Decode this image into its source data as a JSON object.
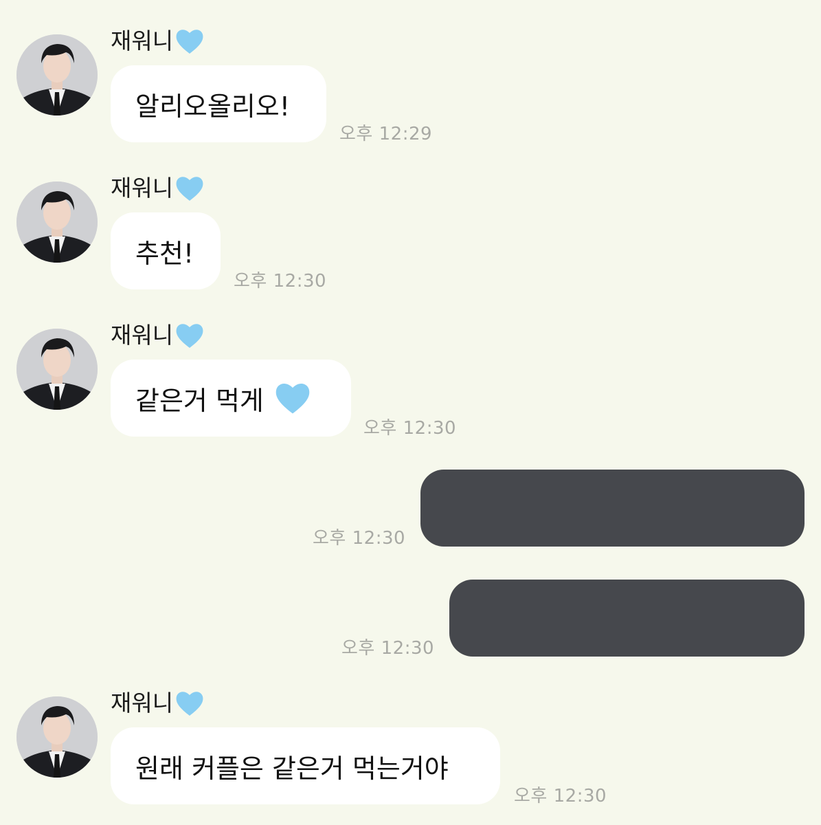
{
  "sender_name": "재워니",
  "colors": {
    "background": "#f6f8ec",
    "incoming_bubble": "#ffffff",
    "outgoing_bubble": "#46484d",
    "timestamp": "#a8a9a4",
    "heart": "#87cdf2"
  },
  "icons": {
    "heart": "blue-heart-icon",
    "avatar": "profile-avatar"
  },
  "messages": [
    {
      "direction": "incoming",
      "text": "알리오올리오!",
      "time": "오후 12:29"
    },
    {
      "direction": "incoming",
      "text": "추천!",
      "time": "오후 12:30"
    },
    {
      "direction": "incoming",
      "text": "같은거 먹게",
      "has_heart_emoji": true,
      "time": "오후 12:30"
    },
    {
      "direction": "outgoing",
      "text": "",
      "redacted": true,
      "time": "오후 12:30"
    },
    {
      "direction": "outgoing",
      "text": "",
      "redacted": true,
      "time": "오후 12:30"
    },
    {
      "direction": "incoming",
      "text": "원래 커플은 같은거 먹는거야",
      "time": "오후 12:30"
    }
  ]
}
